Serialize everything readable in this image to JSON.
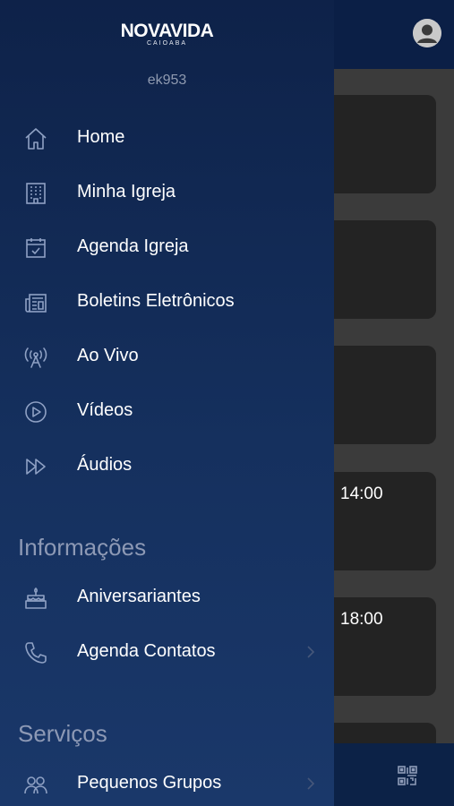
{
  "header": {
    "avatar_icon": "user-avatar-icon"
  },
  "cards": [
    {
      "time": ""
    },
    {
      "time": ""
    },
    {
      "time": ""
    },
    {
      "time": "14:00"
    },
    {
      "time": "18:00"
    }
  ],
  "drawer": {
    "logo": {
      "main": "NOVAVIDA",
      "sub": "CAIOABA"
    },
    "username": "ek953",
    "main_items": [
      {
        "label": "Home",
        "icon": "home-icon"
      },
      {
        "label": "Minha Igreja",
        "icon": "building-icon"
      },
      {
        "label": "Agenda Igreja",
        "icon": "calendar-check-icon"
      },
      {
        "label": "Boletins Eletrônicos",
        "icon": "newspaper-icon"
      },
      {
        "label": "Ao Vivo",
        "icon": "broadcast-antenna-icon"
      },
      {
        "label": "Vídeos",
        "icon": "play-circle-icon"
      },
      {
        "label": "Áudios",
        "icon": "fast-forward-icon"
      }
    ],
    "sections": [
      {
        "title": "Informações",
        "items": [
          {
            "label": "Aniversariantes",
            "icon": "birthday-cake-icon"
          },
          {
            "label": "Agenda Contatos",
            "icon": "phone-icon"
          }
        ]
      },
      {
        "title": "Serviços",
        "items": [
          {
            "label": "Pequenos Grupos",
            "icon": "group-icon"
          }
        ]
      }
    ]
  },
  "bottombar": {
    "qr_icon": "qr-code-icon"
  },
  "colors": {
    "drawer_top": "#0e2249",
    "drawer_bottom": "#1a386a",
    "section_title": "#8d99b5",
    "text": "#ffffff"
  }
}
